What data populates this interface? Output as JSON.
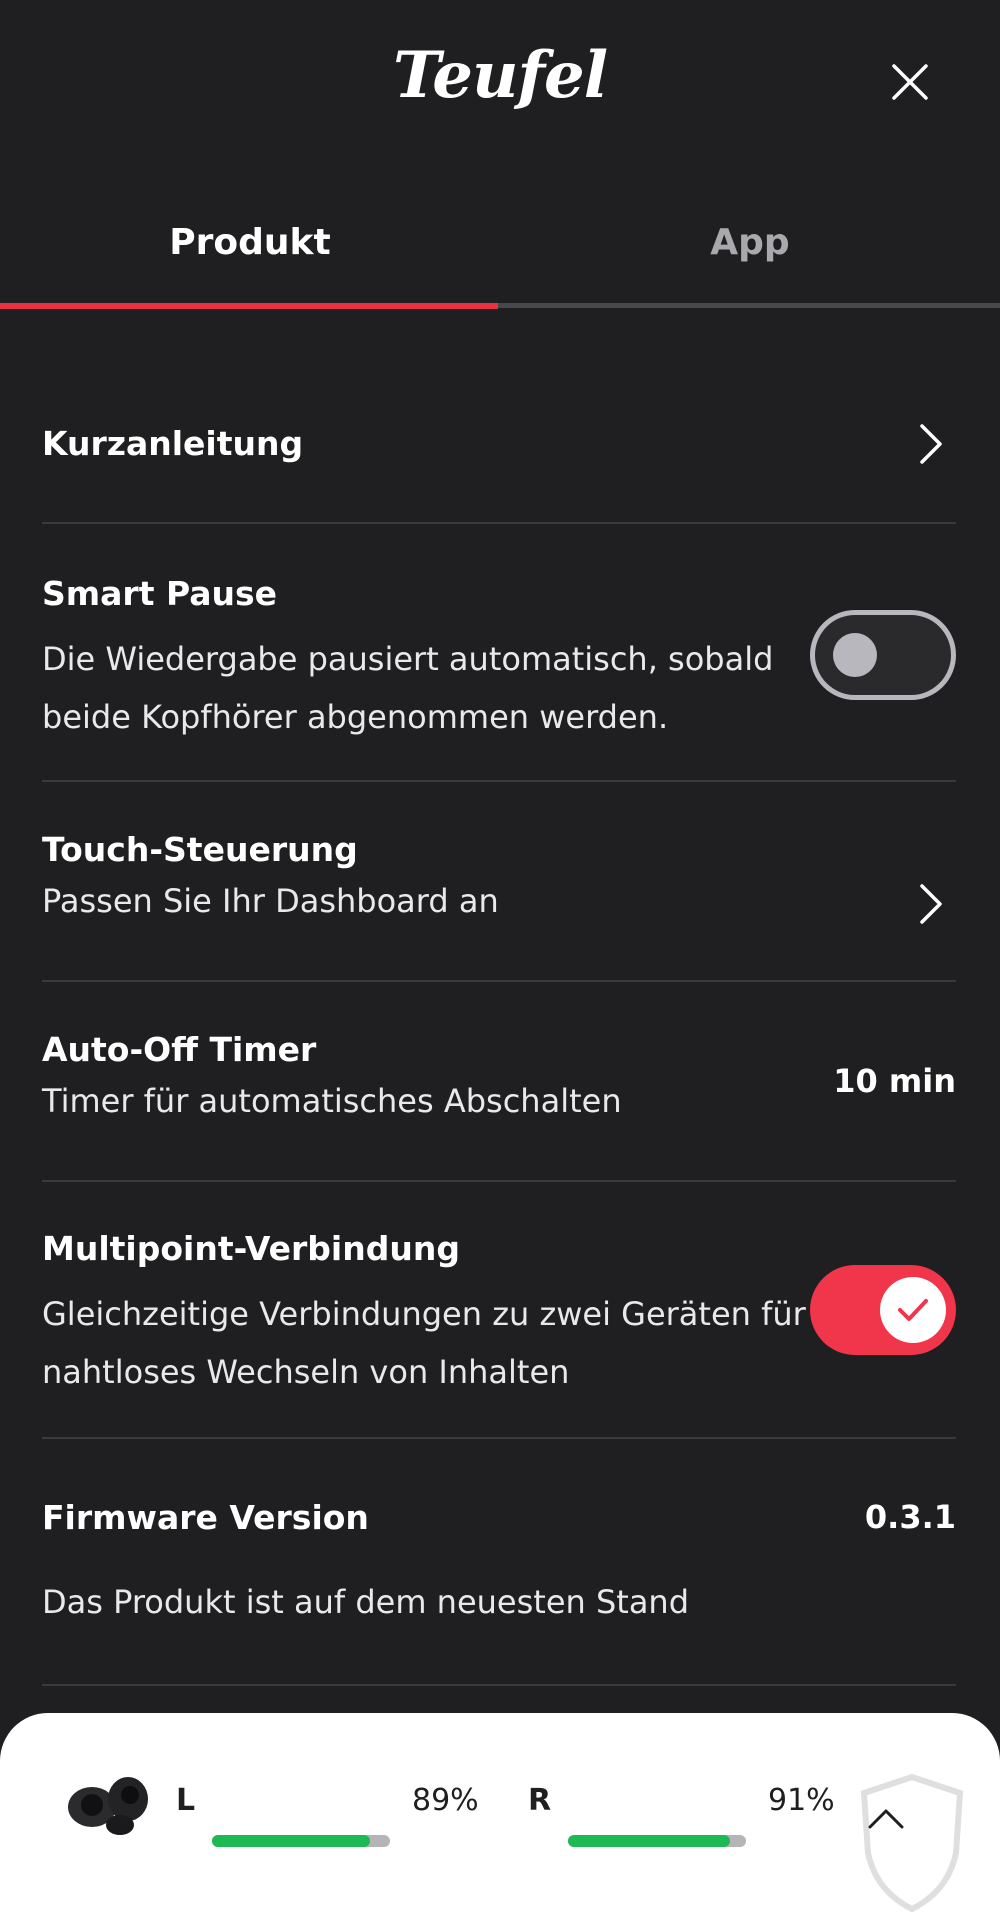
{
  "header": {
    "logo": "Teufel"
  },
  "tabs": [
    {
      "label": "Produkt",
      "active": true
    },
    {
      "label": "App",
      "active": false
    }
  ],
  "rows": {
    "quick_guide": {
      "title": "Kurzanleitung"
    },
    "smart_pause": {
      "title": "Smart Pause",
      "desc_line1": "Die Wiedergabe pausiert automatisch, sobald",
      "desc_line2": "beide Kopfhörer abgenommen werden.",
      "enabled": false
    },
    "touch_control": {
      "title": "Touch-Steuerung",
      "desc": "Passen Sie Ihr Dashboard an"
    },
    "auto_off": {
      "title": "Auto-Off Timer",
      "desc": "Timer für automatisches Abschalten",
      "value": "10 min"
    },
    "multipoint": {
      "title": "Multipoint-Verbindung",
      "desc_line1": "Gleichzeitige Verbindungen zu zwei Geräten für",
      "desc_line2": "nahtloses Wechseln von Inhalten",
      "enabled": true
    },
    "firmware": {
      "title": "Firmware Version",
      "value": "0.3.1",
      "desc": "Das Produkt ist auf dem neuesten Stand"
    }
  },
  "battery": {
    "left": {
      "label": "L",
      "percent_text": "89%",
      "level": 0.89
    },
    "right": {
      "label": "R",
      "percent_text": "91%",
      "level": 0.91
    }
  },
  "colors": {
    "accent": "#e8323f",
    "toggle_on": "#f1354a",
    "battery_fill": "#1db954",
    "background": "#1f1f21"
  },
  "icons": [
    "close-icon",
    "chevron-right-icon",
    "checkmark-icon",
    "earbuds-icon",
    "chevron-up-icon"
  ]
}
